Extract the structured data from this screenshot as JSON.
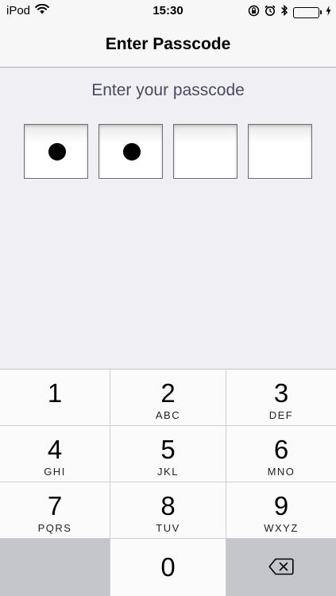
{
  "status_bar": {
    "carrier": "iPod",
    "time": "15:30"
  },
  "nav": {
    "title": "Enter Passcode"
  },
  "prompt": "Enter your passcode",
  "passcode": {
    "length": 4,
    "entered": 2
  },
  "keypad": {
    "keys": [
      {
        "num": "1",
        "letters": ""
      },
      {
        "num": "2",
        "letters": "ABC"
      },
      {
        "num": "3",
        "letters": "DEF"
      },
      {
        "num": "4",
        "letters": "GHI"
      },
      {
        "num": "5",
        "letters": "JKL"
      },
      {
        "num": "6",
        "letters": "MNO"
      },
      {
        "num": "7",
        "letters": "PQRS"
      },
      {
        "num": "8",
        "letters": "TUV"
      },
      {
        "num": "9",
        "letters": "WXYZ"
      },
      {
        "num": "0",
        "letters": ""
      }
    ]
  },
  "icons": {
    "wifi": "wifi-icon",
    "rotation_lock": "rotation-lock-icon",
    "alarm": "alarm-icon",
    "bluetooth": "bluetooth-icon",
    "battery": "battery-icon",
    "charging": "charging-icon",
    "backspace": "backspace-icon"
  },
  "colors": {
    "battery_fill": "#4cd964",
    "background": "#efeff4",
    "prompt_text": "#4a4a5e",
    "gray_key": "#c5c6cb"
  }
}
